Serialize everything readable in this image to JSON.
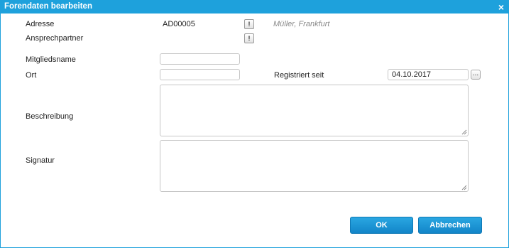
{
  "dialog": {
    "title": "Forendaten bearbeiten",
    "close_glyph": "×"
  },
  "fields": {
    "adresse_label": "Adresse",
    "adresse_value": "AD00005",
    "adresse_info_glyph": "!",
    "adresse_hint": "Müller, Frankfurt",
    "ansprechpartner_label": "Ansprechpartner",
    "ansprechpartner_info_glyph": "!",
    "mitgliedsname_label": "Mitgliedsname",
    "mitgliedsname_value": "",
    "ort_label": "Ort",
    "ort_value": "",
    "registriert_label": "Registriert seit",
    "registriert_value": "04.10.2017",
    "date_picker_glyph": "...",
    "beschreibung_label": "Beschreibung",
    "beschreibung_value": "",
    "signatur_label": "Signatur",
    "signatur_value": ""
  },
  "buttons": {
    "ok": "OK",
    "cancel": "Abbrechen"
  },
  "colors": {
    "accent": "#1ea1dc",
    "button": "#1a8fd0"
  }
}
